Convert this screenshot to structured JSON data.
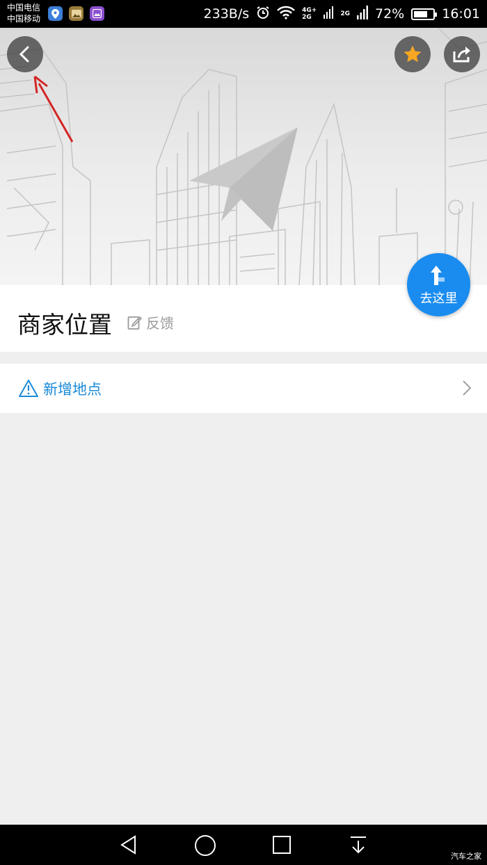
{
  "status_bar": {
    "carrier_1": "中国电信",
    "carrier_2": "中国移动",
    "net_speed": "233B/s",
    "net_tag_1": "4G+",
    "net_tag_2": "2G",
    "net_tag_3": "2G",
    "battery": "72%",
    "battery_level": 0.72,
    "time": "16:01"
  },
  "header": {
    "back_icon": "chevron-left-icon",
    "favorite_icon": "star-icon",
    "share_icon": "share-icon"
  },
  "go_button": {
    "label": "去这里",
    "icon": "turn-arrow-icon"
  },
  "place": {
    "title": "商家位置",
    "feedback_label": "反馈"
  },
  "add_location": {
    "label": "新增地点"
  },
  "watermark": "汽车之家",
  "colors": {
    "accent": "#1a8cf0",
    "link": "#1a8ad8",
    "star": "#f5a623"
  }
}
